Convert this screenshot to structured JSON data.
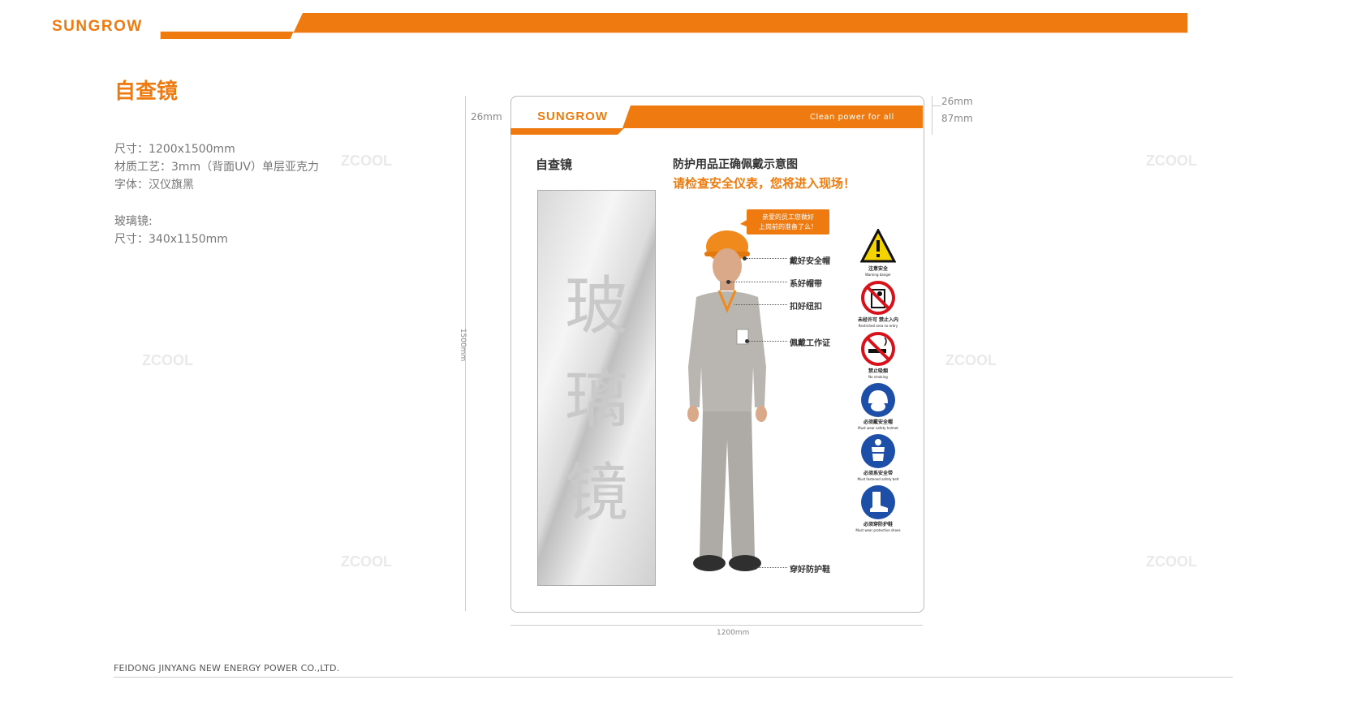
{
  "header": {
    "brand": "SUNGROW",
    "tagline": "Clean power for all",
    "accent_color": "#ef7b10"
  },
  "page": {
    "title": "自查镜"
  },
  "specs": {
    "size": "尺寸：1200x1500mm",
    "material": "材质工艺：3mm（背面UV）单层亚克力",
    "font": "字体：汉仪旗黑",
    "glass_heading": "玻璃镜:",
    "glass_size": "尺寸：340x1150mm"
  },
  "board": {
    "brand": "SUNGROW",
    "tagline": "Clean power for all",
    "title": "自查镜",
    "diagram_title": "防护用品正确佩戴示意图",
    "warning": "请检查安全仪表，您将进入现场！",
    "mirror_chars": [
      "玻",
      "璃",
      "镜"
    ],
    "speech_lines": [
      "亲爱的员工您做好",
      "上岗前的准备了么！"
    ],
    "callouts": [
      "戴好安全帽",
      "系好帽带",
      "扣好纽扣",
      "佩戴工作证",
      "穿好防护鞋"
    ],
    "signs": [
      {
        "icon": "warning-triangle-icon",
        "label": "注意安全",
        "sub": "Warning danger"
      },
      {
        "icon": "no-entry-icon",
        "label": "未经许可 禁止入内",
        "sub": "Restricted area no entry"
      },
      {
        "icon": "no-smoking-icon",
        "label": "禁止吸烟",
        "sub": "No smoking"
      },
      {
        "icon": "helmet-icon",
        "label": "必须戴安全帽",
        "sub": "Must wear safety helmet"
      },
      {
        "icon": "safety-belt-icon",
        "label": "必须系安全带",
        "sub": "Must fastened safety belt"
      },
      {
        "icon": "boot-icon",
        "label": "必须穿防护鞋",
        "sub": "Must wear protective shoes"
      }
    ]
  },
  "dimensions": {
    "top_margin": "26mm",
    "band_height": "87mm",
    "left_margin": "26mm",
    "height": "1500mm",
    "width": "1200mm"
  },
  "footer": {
    "company": "FEIDONG JINYANG NEW ENERGY POWER CO.,LTD."
  },
  "watermark": {
    "text": "ZCOOL"
  }
}
